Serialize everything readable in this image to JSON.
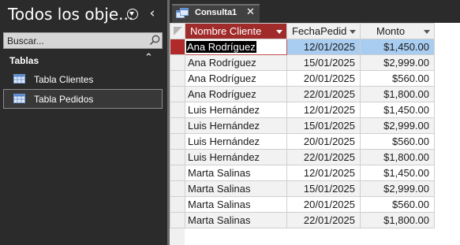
{
  "nav": {
    "title": "Todos los obje...",
    "search_placeholder": "Buscar...",
    "group_label": "Tablas",
    "items": [
      {
        "label": "Tabla Clientes",
        "icon": "table-icon",
        "selected": false
      },
      {
        "label": "Tabla Pedidos",
        "icon": "table-icon",
        "selected": true
      }
    ]
  },
  "tab": {
    "label": "Consulta1",
    "icon": "query-icon"
  },
  "grid": {
    "columns": [
      "Nombre Cliente",
      "FechaPedid",
      "Monto"
    ],
    "rows": [
      [
        "Ana Rodríguez",
        "12/01/2025",
        "$1,450.00"
      ],
      [
        "Ana Rodríguez",
        "15/01/2025",
        "$2,999.00"
      ],
      [
        "Ana Rodríguez",
        "20/01/2025",
        "$560.00"
      ],
      [
        "Ana Rodríguez",
        "22/01/2025",
        "$1,800.00"
      ],
      [
        "Luis Hernández",
        "12/01/2025",
        "$1,450.00"
      ],
      [
        "Luis Hernández",
        "15/01/2025",
        "$2,999.00"
      ],
      [
        "Luis Hernández",
        "20/01/2025",
        "$560.00"
      ],
      [
        "Luis Hernández",
        "22/01/2025",
        "$1,800.00"
      ],
      [
        "Marta Salinas",
        "12/01/2025",
        "$1,450.00"
      ],
      [
        "Marta Salinas",
        "15/01/2025",
        "$2,999.00"
      ],
      [
        "Marta Salinas",
        "20/01/2025",
        "$560.00"
      ],
      [
        "Marta Salinas",
        "22/01/2025",
        "$1,800.00"
      ]
    ]
  },
  "colors": {
    "nav_bg": "#2b2b2b",
    "active_header": "#a02b2b",
    "record_selector": "#b02a2a",
    "highlight": "#a9cdf0"
  }
}
